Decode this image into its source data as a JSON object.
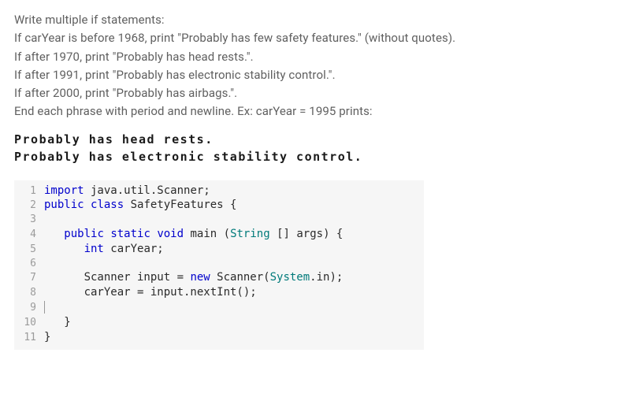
{
  "instructions": {
    "line1": "Write multiple if statements:",
    "line2": "If carYear is before 1968, print \"Probably has few safety features.\" (without quotes).",
    "line3": "If after 1970, print \"Probably has head rests.\".",
    "line4": "If after 1991, print \"Probably has electronic stability control.\".",
    "line5": "If after 2000, print \"Probably has airbags.\".",
    "line6": "End each phrase with period and newline. Ex: carYear = 1995 prints:"
  },
  "example": {
    "line1": "Probably has head rests.",
    "line2": "Probably has electronic stability control."
  },
  "code": {
    "lines": [
      {
        "n": "1",
        "tokens": [
          [
            "kw",
            "import"
          ],
          [
            "pun",
            " java.util.Scanner;"
          ]
        ]
      },
      {
        "n": "2",
        "tokens": [
          [
            "kw",
            "public"
          ],
          [
            "pun",
            " "
          ],
          [
            "kw",
            "class"
          ],
          [
            "pun",
            " SafetyFeatures {"
          ]
        ]
      },
      {
        "n": "3",
        "tokens": []
      },
      {
        "n": "4",
        "tokens": [
          [
            "pun",
            "   "
          ],
          [
            "kw",
            "public"
          ],
          [
            "pun",
            " "
          ],
          [
            "kw",
            "static"
          ],
          [
            "pun",
            " "
          ],
          [
            "kw",
            "void"
          ],
          [
            "pun",
            " main ("
          ],
          [
            "type",
            "String"
          ],
          [
            "pun",
            " [] args) {"
          ]
        ]
      },
      {
        "n": "5",
        "tokens": [
          [
            "pun",
            "      "
          ],
          [
            "kw",
            "int"
          ],
          [
            "pun",
            " carYear;"
          ]
        ]
      },
      {
        "n": "6",
        "tokens": []
      },
      {
        "n": "7",
        "tokens": [
          [
            "pun",
            "      Scanner input = "
          ],
          [
            "kw",
            "new"
          ],
          [
            "pun",
            " Scanner("
          ],
          [
            "type",
            "System"
          ],
          [
            "pun",
            ".in);"
          ]
        ]
      },
      {
        "n": "8",
        "tokens": [
          [
            "pun",
            "      carYear = input.nextInt();"
          ]
        ]
      },
      {
        "n": "9",
        "tokens": [
          [
            "caret",
            ""
          ]
        ]
      },
      {
        "n": "10",
        "tokens": [
          [
            "pun",
            "   }"
          ]
        ]
      },
      {
        "n": "11",
        "tokens": [
          [
            "pun",
            "}"
          ]
        ]
      }
    ]
  }
}
